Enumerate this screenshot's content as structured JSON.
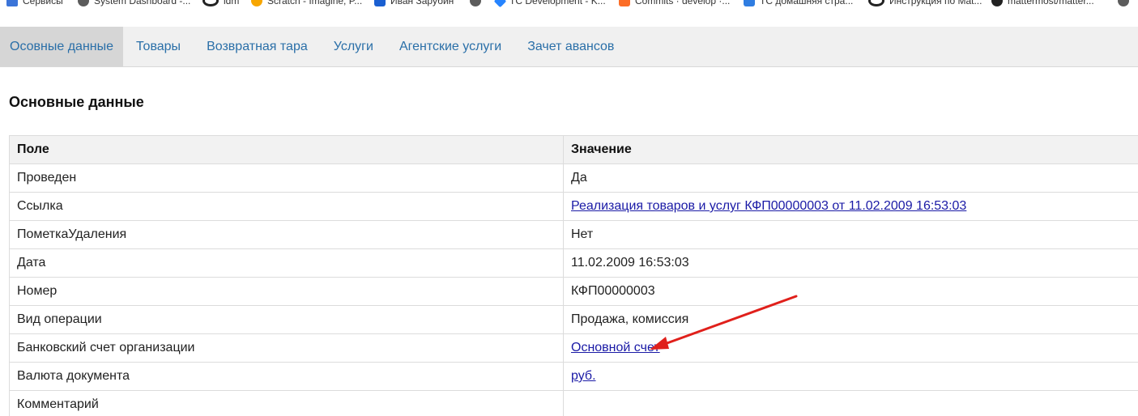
{
  "bookmarks": [
    {
      "label": "Сервисы",
      "icon": "apps-grid-icon"
    },
    {
      "label": "System Dashboard -...",
      "icon": "globe-icon"
    },
    {
      "label": "idm",
      "icon": "g-logo-icon"
    },
    {
      "label": "Scratch - Imagine, P...",
      "icon": "bitbucket-icon"
    },
    {
      "label": "Иван Зарубин",
      "icon": "vk-icon"
    },
    {
      "label": "",
      "icon": "globe-icon"
    },
    {
      "label": "TC Development - K...",
      "icon": "jira-icon"
    },
    {
      "label": "Commits · develop ·...",
      "icon": "gitlab-icon"
    },
    {
      "label": "TC домашняя стра...",
      "icon": "confluence-icon"
    },
    {
      "label": "Инструкция по Mat...",
      "icon": "g-logo-icon"
    },
    {
      "label": "mattermost/matter...",
      "icon": "github-icon"
    },
    {
      "label": "",
      "icon": "globe-icon"
    }
  ],
  "tabs": [
    {
      "label": "Осовные данные",
      "active": true
    },
    {
      "label": "Товары",
      "active": false
    },
    {
      "label": "Возвратная тара",
      "active": false
    },
    {
      "label": "Услуги",
      "active": false
    },
    {
      "label": "Агентские услуги",
      "active": false
    },
    {
      "label": "Зачет авансов",
      "active": false
    }
  ],
  "section": {
    "title": "Основные данные"
  },
  "table": {
    "headers": [
      "Поле",
      "Значение"
    ],
    "rows": [
      {
        "field": "Проведен",
        "value": "Да",
        "link": false
      },
      {
        "field": "Ссылка",
        "value": "Реализация товаров и услуг КФП00000003 от 11.02.2009 16:53:03",
        "link": true
      },
      {
        "field": "ПометкаУдаления",
        "value": "Нет",
        "link": false
      },
      {
        "field": "Дата",
        "value": "11.02.2009 16:53:03",
        "link": false
      },
      {
        "field": "Номер",
        "value": "КФП00000003",
        "link": false
      },
      {
        "field": "Вид операции",
        "value": "Продажа, комиссия",
        "link": false
      },
      {
        "field": "Банковский счет организации",
        "value": "Основной счет",
        "link": true
      },
      {
        "field": "Валюта документа",
        "value": "руб.",
        "link": true
      },
      {
        "field": "Комментарий",
        "value": "",
        "link": false
      }
    ]
  },
  "colors": {
    "annotation_arrow": "#e0201b",
    "tab_text": "#2a6fa8",
    "link_text": "#1a1aa6"
  }
}
